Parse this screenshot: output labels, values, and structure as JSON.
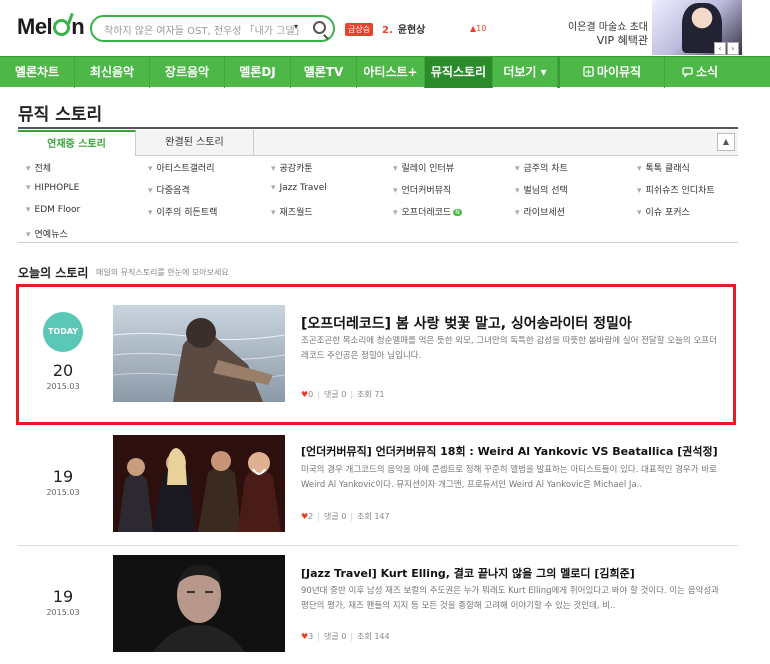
{
  "header": {
    "logo_left": "Mel",
    "logo_right": "n",
    "search_placeholder": "착하지 않은 여자들 OST, 전우성 「내가 그댈」",
    "search_dropdown": "▾",
    "rising_badge": "급상승",
    "rising_rank": "2.",
    "rising_name": "윤현상",
    "rising_change": "▲10",
    "promo_line1": "이은결 마술쇼 초대",
    "promo_line2": "VIP 혜택관",
    "prev_arrow": "‹",
    "next_arrow": "›"
  },
  "nav": {
    "items": [
      {
        "label": "멜론차트"
      },
      {
        "label": "최신음악"
      },
      {
        "label": "장르음악"
      },
      {
        "label": "멜론DJ"
      },
      {
        "label": "멜론TV"
      },
      {
        "label": "아티스트+"
      },
      {
        "label": "뮤직스토리"
      },
      {
        "label": "더보기 ▾"
      },
      {
        "label": "마이뮤직"
      },
      {
        "label": "소식"
      }
    ]
  },
  "page": {
    "title": "뮤직 스토리",
    "tabs": [
      {
        "label": "연재중 스토리"
      },
      {
        "label": "완결된 스토리"
      }
    ],
    "tab_toggle": "▲"
  },
  "categories": [
    "전체",
    "아티스트갤러리",
    "공감카툰",
    "릴레이 인터뷰",
    "금주의 차트",
    "톡톡 클래식",
    "HIPHOPLE",
    "다중음격",
    "Jazz Travel",
    "언더커버뮤직",
    "벌님의 선택",
    "피쉬슈즈 인디차트",
    "EDM Floor",
    "이주의 히든트랙",
    "재즈월드",
    "오프더레코드",
    "라이브세션",
    "이슈 포커스",
    "연예뉴스"
  ],
  "new_badge": "N",
  "today": {
    "title": "오늘의 스토리",
    "subtitle": "매일의 뮤직스토리를 한눈에 모아보세요"
  },
  "stories": [
    {
      "badge": "TODAY",
      "day": "20",
      "ym": "2015.03",
      "title": "[오프더레코드] 봄 사랑 벚꽃 말고, 싱어송라이터 정밀아",
      "desc": "조곤조곤한 목소리에 청순멜매를 먹은 듯한 외모, 그녀만의 독특한 감성을 따뜻한 봄바람에 실어 전달할 오늘의 오프더레코드 주인공은 정밀아 님입니다.",
      "likes": "0",
      "comments_label": "댓글",
      "comments": "0",
      "views_label": "조회",
      "views": "71"
    },
    {
      "day": "19",
      "ym": "2015.03",
      "title": "[언더커버뮤직] 언더커버뮤직 18회 : Weird Al Yankovic VS Beatallica [권석정]",
      "desc": "미국의 경우 개그코드의 음악을 아예 콘셉트로 정해 꾸준히 앨범을 발표하는 아티스트들이 있다. 대표적인 경우가 바로 Weird Al Yankovic이다. 뮤지션이자 개그맨, 프로듀서인 Weird Al Yankovic은 Michael Ja..",
      "likes": "2",
      "comments_label": "댓글",
      "comments": "0",
      "views_label": "조회",
      "views": "147"
    },
    {
      "day": "19",
      "ym": "2015.03",
      "title": "[Jazz Travel] Kurt Elling, 결코 끝나지 않을 그의 멜로디 [김희준]",
      "desc": "90년대 중반 이후 남성 재즈 보컬의 주도권은 누가 뭐래도 Kurt Elling에게 쥐어있다고 봐야 할 것이다. 이는 음악성과 평단의 평가, 재즈 팬들의 지지 등 모든 것을 종합해 고려해 이야기할 수 있는 것인데, 비..",
      "likes": "3",
      "comments_label": "댓글",
      "comments": "0",
      "views_label": "조회",
      "views": "144"
    }
  ]
}
